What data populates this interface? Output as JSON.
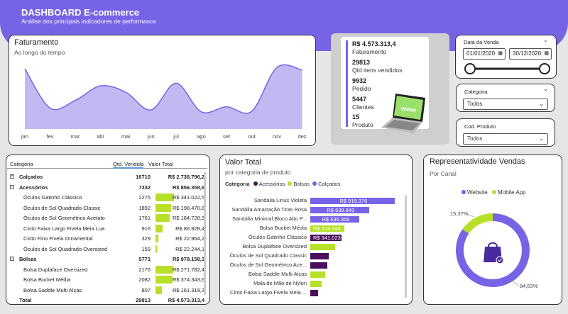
{
  "header": {
    "title": "DASHBOARD E-commerce",
    "subtitle": "Análise dos principais indicadores de performance"
  },
  "colors": {
    "purple": "#7664e6",
    "lime": "#b8e029",
    "dark": "#4a0e5c",
    "lilac": "#c3b9f2"
  },
  "faturamento": {
    "title": "Faturamento",
    "subtitle": "Ao longo do tempo",
    "chart_data": {
      "type": "area",
      "categories": [
        "jan",
        "fev",
        "mar",
        "abr",
        "mai",
        "jun",
        "jul",
        "ago",
        "set",
        "out",
        "nov",
        "dez"
      ],
      "values": [
        95,
        33,
        45,
        68,
        58,
        30,
        72,
        27,
        35,
        28,
        97,
        93
      ],
      "ylim": [
        0,
        105
      ]
    }
  },
  "kpis": [
    {
      "value": "R$ 4.573.313,4",
      "label": "Faturamento"
    },
    {
      "value": "29813",
      "label": "Qtd itens vendidos"
    },
    {
      "value": "9932",
      "label": "Pedido"
    },
    {
      "value": "5447",
      "label": "Clientes"
    },
    {
      "value": "15",
      "label": "Produto"
    }
  ],
  "filters": {
    "date": {
      "label": "Data da Venda",
      "start": "01/01/2020",
      "end": "30/12/2020"
    },
    "categoria": {
      "label": "Categoria",
      "value": "Todos"
    },
    "produto": {
      "label": "Cod. Produto",
      "value": "Todos"
    }
  },
  "table": {
    "headers": [
      "Categoria",
      "Qtd. Vendida",
      "Valor Total"
    ],
    "rows": [
      {
        "name": "Calçados",
        "qty": "16710",
        "val": "R$ 2.738.796,2",
        "type": "group",
        "icon": "plus"
      },
      {
        "name": "Acessórios",
        "qty": "7332",
        "val": "R$ 856.358,9",
        "type": "group",
        "icon": "minus"
      },
      {
        "name": "Óculos Gatinho Clássico",
        "qty": "2275",
        "val": "R$ 341.022,5",
        "type": "item",
        "bar": 1.0
      },
      {
        "name": "Óculos de Sol Quadrado Classic",
        "qty": "1892",
        "val": "R$ 198.470,8",
        "type": "item",
        "bar": 0.83
      },
      {
        "name": "Óculos de Sol Geométrico Acetato",
        "qty": "1761",
        "val": "R$ 184.728,9",
        "type": "item",
        "bar": 0.77
      },
      {
        "name": "Cinto Faixa Largo Fivela Meia Lua",
        "qty": "916",
        "val": "R$ 86.928,4",
        "type": "item",
        "bar": 0.4
      },
      {
        "name": "Cinto Fino Fivela Ornamental",
        "qty": "329",
        "val": "R$ 22.964,2",
        "type": "item",
        "bar": 0.14
      },
      {
        "name": "Óculos de Sol Quadrado Oversized",
        "qty": "159",
        "val": "R$ 22.244,1",
        "type": "item",
        "bar": 0.07
      },
      {
        "name": "Bolsas",
        "qty": "5771",
        "val": "R$ 978.158,3",
        "type": "group",
        "icon": "minus"
      },
      {
        "name": "Bolsa Duplaface Oversized",
        "qty": "2176",
        "val": "R$ 271.782,4",
        "type": "item",
        "bar": 0.96
      },
      {
        "name": "Bolsa Bucket Média",
        "qty": "2082",
        "val": "R$ 374.343,6",
        "type": "item",
        "bar": 0.92
      },
      {
        "name": "Bolsa Saddle Multi Alças",
        "qty": "807",
        "val": "R$ 161.319,3",
        "type": "item",
        "bar": 0.36
      },
      {
        "name": "Total",
        "qty": "29813",
        "val": "R$ 4.573.313,4",
        "type": "total"
      }
    ]
  },
  "valor_total": {
    "title": "Valor Total",
    "subtitle": "por categoria de produto",
    "legend_title": "Categoria",
    "legend": [
      {
        "name": "Acessórios",
        "color": "#4a0e5c"
      },
      {
        "name": "Bolsas",
        "color": "#b8e029"
      },
      {
        "name": "Calçados",
        "color": "#7664e6"
      }
    ],
    "chart_data": {
      "type": "bar",
      "orientation": "horizontal",
      "categories": [
        "Sandália Linus Violeta",
        "Sandália Amarração Tiras Rosa",
        "Sandália Minimal Bloco Alto P...",
        "Bolsa Bucket Média",
        "Óculos Gatinho Clássico",
        "Bolsa Duplaface Oversized",
        "Óculos de Sol Quadrado Classic",
        "Óculos de Sol Geométrico Ace...",
        "Bolsa Saddle Multi Alças",
        "Mala de Mão de Nylon",
        "Cinto Faixa Largo Fivela Meia ..."
      ],
      "values": [
        919376,
        639843,
        535355,
        374344,
        341023,
        271782,
        198471,
        184729,
        161319,
        120000,
        86928
      ],
      "groups": [
        "Calçados",
        "Calçados",
        "Calçados",
        "Bolsas",
        "Acessórios",
        "Bolsas",
        "Acessórios",
        "Acessórios",
        "Bolsas",
        "Bolsas",
        "Acessórios"
      ],
      "labels": [
        "R$ 919.376",
        "R$ 639.843",
        "R$ 535.355",
        "R$ 374.344",
        "R$ 341.023",
        "",
        "",
        "",
        "",
        "",
        ""
      ]
    }
  },
  "representatividade": {
    "title": "Representatividade Vendas",
    "subtitle": "Por Canal",
    "legend": [
      {
        "name": "Website",
        "color": "#7664e6"
      },
      {
        "name": "Mobile App",
        "color": "#b8e029"
      }
    ],
    "chart_data": {
      "type": "pie",
      "categories": [
        "Website",
        "Mobile App"
      ],
      "values": [
        84.63,
        15.37
      ],
      "labels": [
        "84,63%",
        "15,37%"
      ]
    }
  }
}
